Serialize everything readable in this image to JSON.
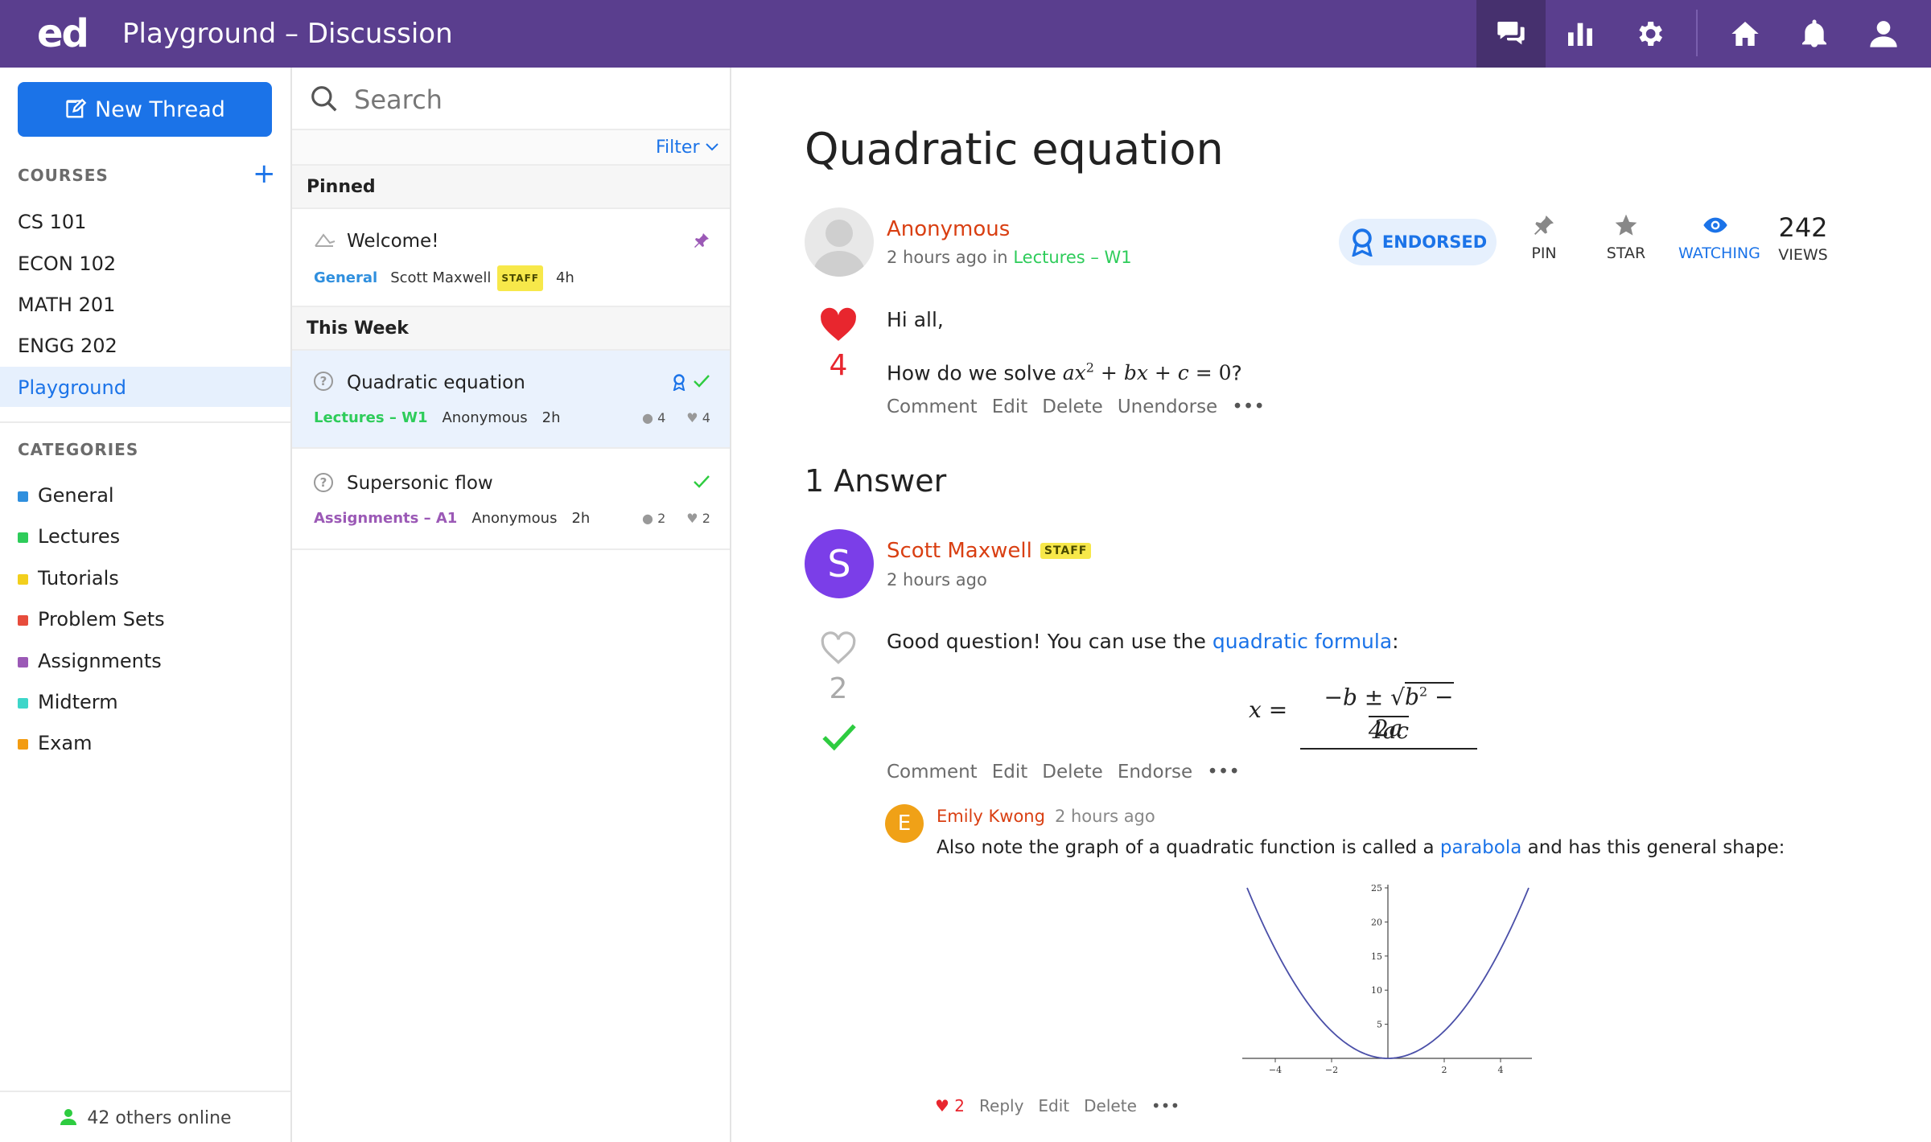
{
  "app": {
    "logo": "ed",
    "title": "Playground – Discussion"
  },
  "topbar_icons": [
    "discussion-icon",
    "analytics-icon",
    "settings-icon",
    "home-icon",
    "notifications-icon",
    "profile-icon"
  ],
  "sidebar": {
    "new_thread_label": "New Thread",
    "courses_heading": "COURSES",
    "courses": [
      "CS 101",
      "ECON 102",
      "MATH 201",
      "ENGG 202",
      "Playground"
    ],
    "active_course": "Playground",
    "categories_heading": "CATEGORIES",
    "categories": [
      {
        "label": "General",
        "color": "#2f8fde"
      },
      {
        "label": "Lectures",
        "color": "#2ecc5a"
      },
      {
        "label": "Tutorials",
        "color": "#f2cf1d"
      },
      {
        "label": "Problem Sets",
        "color": "#e74c3c"
      },
      {
        "label": "Assignments",
        "color": "#9b59b6"
      },
      {
        "label": "Midterm",
        "color": "#3dd6c9"
      },
      {
        "label": "Exam",
        "color": "#f39c12"
      }
    ],
    "online_text": "42 others online"
  },
  "threadlist": {
    "search_placeholder": "Search",
    "filter_label": "Filter",
    "groups": {
      "pinned": "Pinned",
      "this_week": "This Week"
    },
    "threads": [
      {
        "title": "Welcome!",
        "category": "General",
        "category_color": "#2f8fde",
        "author": "Scott Maxwell",
        "staff_badge": "STAFF",
        "time": "4h"
      },
      {
        "title": "Quadratic equation",
        "category": "Lectures – W1",
        "category_color": "#2ecc5a",
        "author": "Anonymous",
        "time": "2h",
        "comments": "4",
        "likes": "4"
      },
      {
        "title": "Supersonic flow",
        "category": "Assignments – A1",
        "category_color": "#9b59b6",
        "author": "Anonymous",
        "time": "2h",
        "comments": "2",
        "likes": "2"
      }
    ]
  },
  "post": {
    "title": "Quadratic equation",
    "author": "Anonymous",
    "time_prefix": "2 hours ago in",
    "category": "Lectures – W1",
    "endorsed_label": "ENDORSED",
    "controls": {
      "pin": "PIN",
      "star": "STAR",
      "watching": "WATCHING",
      "views_count": "242",
      "views_label": "VIEWS"
    },
    "likes": "4",
    "greeting": "Hi all,",
    "question_prefix": "How do we solve",
    "question_suffix": "?",
    "actions": [
      "Comment",
      "Edit",
      "Delete",
      "Unendorse",
      "•••"
    ]
  },
  "answers": {
    "heading": "1 Answer",
    "answer": {
      "avatar_letter": "S",
      "author": "Scott Maxwell",
      "staff_badge": "STAFF",
      "time": "2 hours ago",
      "likes": "2",
      "text_prefix": "Good question! You can use the",
      "link_text": "quadratic formula",
      "text_suffix": ":",
      "actions": [
        "Comment",
        "Edit",
        "Delete",
        "Endorse",
        "•••"
      ]
    },
    "comment": {
      "avatar_letter": "E",
      "author": "Emily Kwong",
      "time": "2 hours ago",
      "text_prefix": "Also note the graph of a quadratic function is called a",
      "link_text": "parabola",
      "text_suffix": "and has this general shape:",
      "likes": "2",
      "actions": [
        "Reply",
        "Edit",
        "Delete",
        "•••"
      ]
    }
  },
  "chart_data": {
    "type": "line",
    "function": "y = x^2",
    "xlim": [
      -5,
      5
    ],
    "ylim": [
      0,
      25
    ],
    "x_ticks": [
      "-4",
      "-2",
      "2",
      "4"
    ],
    "y_ticks": [
      "5",
      "10",
      "15",
      "20",
      "25"
    ],
    "line_color": "#4a4fa8",
    "grid": false
  }
}
